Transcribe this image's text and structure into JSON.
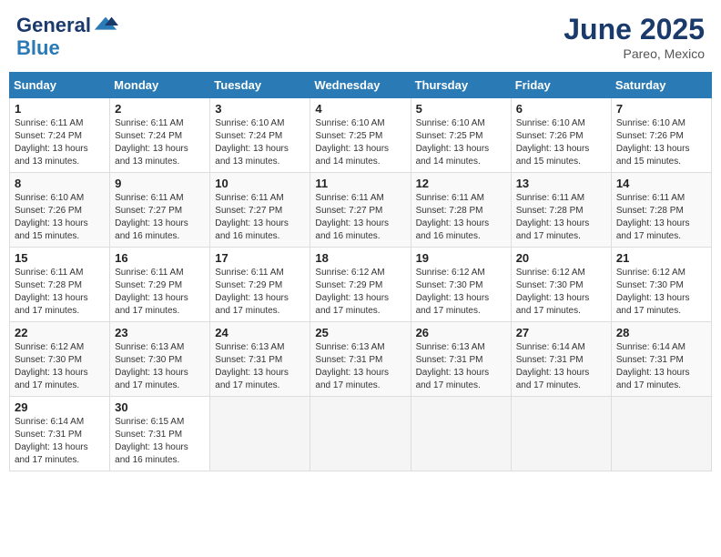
{
  "header": {
    "logo_general": "General",
    "logo_blue": "Blue",
    "month": "June 2025",
    "location": "Pareo, Mexico"
  },
  "weekdays": [
    "Sunday",
    "Monday",
    "Tuesday",
    "Wednesday",
    "Thursday",
    "Friday",
    "Saturday"
  ],
  "weeks": [
    [
      {
        "day": "1",
        "lines": [
          "Sunrise: 6:11 AM",
          "Sunset: 7:24 PM",
          "Daylight: 13 hours",
          "and 13 minutes."
        ]
      },
      {
        "day": "2",
        "lines": [
          "Sunrise: 6:11 AM",
          "Sunset: 7:24 PM",
          "Daylight: 13 hours",
          "and 13 minutes."
        ]
      },
      {
        "day": "3",
        "lines": [
          "Sunrise: 6:10 AM",
          "Sunset: 7:24 PM",
          "Daylight: 13 hours",
          "and 13 minutes."
        ]
      },
      {
        "day": "4",
        "lines": [
          "Sunrise: 6:10 AM",
          "Sunset: 7:25 PM",
          "Daylight: 13 hours",
          "and 14 minutes."
        ]
      },
      {
        "day": "5",
        "lines": [
          "Sunrise: 6:10 AM",
          "Sunset: 7:25 PM",
          "Daylight: 13 hours",
          "and 14 minutes."
        ]
      },
      {
        "day": "6",
        "lines": [
          "Sunrise: 6:10 AM",
          "Sunset: 7:26 PM",
          "Daylight: 13 hours",
          "and 15 minutes."
        ]
      },
      {
        "day": "7",
        "lines": [
          "Sunrise: 6:10 AM",
          "Sunset: 7:26 PM",
          "Daylight: 13 hours",
          "and 15 minutes."
        ]
      }
    ],
    [
      {
        "day": "8",
        "lines": [
          "Sunrise: 6:10 AM",
          "Sunset: 7:26 PM",
          "Daylight: 13 hours",
          "and 15 minutes."
        ]
      },
      {
        "day": "9",
        "lines": [
          "Sunrise: 6:11 AM",
          "Sunset: 7:27 PM",
          "Daylight: 13 hours",
          "and 16 minutes."
        ]
      },
      {
        "day": "10",
        "lines": [
          "Sunrise: 6:11 AM",
          "Sunset: 7:27 PM",
          "Daylight: 13 hours",
          "and 16 minutes."
        ]
      },
      {
        "day": "11",
        "lines": [
          "Sunrise: 6:11 AM",
          "Sunset: 7:27 PM",
          "Daylight: 13 hours",
          "and 16 minutes."
        ]
      },
      {
        "day": "12",
        "lines": [
          "Sunrise: 6:11 AM",
          "Sunset: 7:28 PM",
          "Daylight: 13 hours",
          "and 16 minutes."
        ]
      },
      {
        "day": "13",
        "lines": [
          "Sunrise: 6:11 AM",
          "Sunset: 7:28 PM",
          "Daylight: 13 hours",
          "and 17 minutes."
        ]
      },
      {
        "day": "14",
        "lines": [
          "Sunrise: 6:11 AM",
          "Sunset: 7:28 PM",
          "Daylight: 13 hours",
          "and 17 minutes."
        ]
      }
    ],
    [
      {
        "day": "15",
        "lines": [
          "Sunrise: 6:11 AM",
          "Sunset: 7:28 PM",
          "Daylight: 13 hours",
          "and 17 minutes."
        ]
      },
      {
        "day": "16",
        "lines": [
          "Sunrise: 6:11 AM",
          "Sunset: 7:29 PM",
          "Daylight: 13 hours",
          "and 17 minutes."
        ]
      },
      {
        "day": "17",
        "lines": [
          "Sunrise: 6:11 AM",
          "Sunset: 7:29 PM",
          "Daylight: 13 hours",
          "and 17 minutes."
        ]
      },
      {
        "day": "18",
        "lines": [
          "Sunrise: 6:12 AM",
          "Sunset: 7:29 PM",
          "Daylight: 13 hours",
          "and 17 minutes."
        ]
      },
      {
        "day": "19",
        "lines": [
          "Sunrise: 6:12 AM",
          "Sunset: 7:30 PM",
          "Daylight: 13 hours",
          "and 17 minutes."
        ]
      },
      {
        "day": "20",
        "lines": [
          "Sunrise: 6:12 AM",
          "Sunset: 7:30 PM",
          "Daylight: 13 hours",
          "and 17 minutes."
        ]
      },
      {
        "day": "21",
        "lines": [
          "Sunrise: 6:12 AM",
          "Sunset: 7:30 PM",
          "Daylight: 13 hours",
          "and 17 minutes."
        ]
      }
    ],
    [
      {
        "day": "22",
        "lines": [
          "Sunrise: 6:12 AM",
          "Sunset: 7:30 PM",
          "Daylight: 13 hours",
          "and 17 minutes."
        ]
      },
      {
        "day": "23",
        "lines": [
          "Sunrise: 6:13 AM",
          "Sunset: 7:30 PM",
          "Daylight: 13 hours",
          "and 17 minutes."
        ]
      },
      {
        "day": "24",
        "lines": [
          "Sunrise: 6:13 AM",
          "Sunset: 7:31 PM",
          "Daylight: 13 hours",
          "and 17 minutes."
        ]
      },
      {
        "day": "25",
        "lines": [
          "Sunrise: 6:13 AM",
          "Sunset: 7:31 PM",
          "Daylight: 13 hours",
          "and 17 minutes."
        ]
      },
      {
        "day": "26",
        "lines": [
          "Sunrise: 6:13 AM",
          "Sunset: 7:31 PM",
          "Daylight: 13 hours",
          "and 17 minutes."
        ]
      },
      {
        "day": "27",
        "lines": [
          "Sunrise: 6:14 AM",
          "Sunset: 7:31 PM",
          "Daylight: 13 hours",
          "and 17 minutes."
        ]
      },
      {
        "day": "28",
        "lines": [
          "Sunrise: 6:14 AM",
          "Sunset: 7:31 PM",
          "Daylight: 13 hours",
          "and 17 minutes."
        ]
      }
    ],
    [
      {
        "day": "29",
        "lines": [
          "Sunrise: 6:14 AM",
          "Sunset: 7:31 PM",
          "Daylight: 13 hours",
          "and 17 minutes."
        ]
      },
      {
        "day": "30",
        "lines": [
          "Sunrise: 6:15 AM",
          "Sunset: 7:31 PM",
          "Daylight: 13 hours",
          "and 16 minutes."
        ]
      },
      {
        "day": "",
        "lines": []
      },
      {
        "day": "",
        "lines": []
      },
      {
        "day": "",
        "lines": []
      },
      {
        "day": "",
        "lines": []
      },
      {
        "day": "",
        "lines": []
      }
    ]
  ]
}
